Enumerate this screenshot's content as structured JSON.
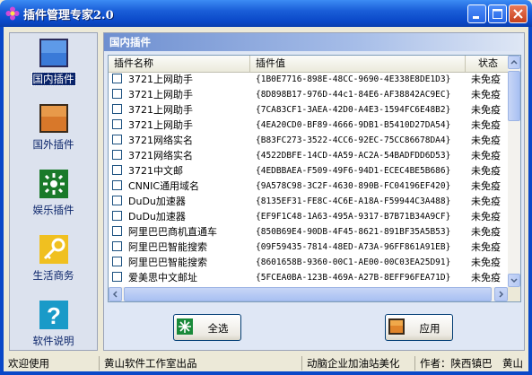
{
  "window": {
    "title": "插件管理专家2.0"
  },
  "sidebar": {
    "items": [
      {
        "label": "国内插件",
        "icon": "monitor-blue-icon",
        "active": true
      },
      {
        "label": "国外插件",
        "icon": "monitor-orange-icon",
        "active": false
      },
      {
        "label": "娱乐插件",
        "icon": "sparkle-green-icon",
        "active": false
      },
      {
        "label": "生活商务",
        "icon": "key-icon",
        "active": false
      },
      {
        "label": "软件说明",
        "icon": "help-icon",
        "active": false
      }
    ]
  },
  "panel": {
    "title": "国内插件",
    "columns": {
      "name": "插件名称",
      "value": "插件值",
      "status": "状态"
    },
    "rows": [
      {
        "name": "3721上网助手",
        "value": "{1B0E7716-898E-48CC-9690-4E338E8DE1D3}",
        "status": "未免疫"
      },
      {
        "name": "3721上网助手",
        "value": "{8D898B17-976D-44c1-84E6-AF38842AC9EC}",
        "status": "未免疫"
      },
      {
        "name": "3721上网助手",
        "value": "{7CA83CF1-3AEA-42D0-A4E3-1594FC6E48B2}",
        "status": "未免疫"
      },
      {
        "name": "3721上网助手",
        "value": "{4EA20CD0-BF89-4666-9DB1-B5410D27DA54}",
        "status": "未免疫"
      },
      {
        "name": "3721网络实名",
        "value": "{B83FC273-3522-4CC6-92EC-75CC86678DA4}",
        "status": "未免疫"
      },
      {
        "name": "3721网络实名",
        "value": "{4522DBFE-14CD-4A59-AC2A-54BADFDD6D53}",
        "status": "未免疫"
      },
      {
        "name": "3721中文邮",
        "value": "{4EDBBAEA-F509-49F6-94D1-ECEC4BE5B686}",
        "status": "未免疫"
      },
      {
        "name": "CNNIC通用域名",
        "value": "{9A578C98-3C2F-4630-890B-FC04196EF420}",
        "status": "未免疫"
      },
      {
        "name": "DuDu加速器",
        "value": "{8135EF31-FE8C-4C6E-A18A-F59944C3A488}",
        "status": "未免疫"
      },
      {
        "name": "DuDu加速器",
        "value": "{EF9F1C48-1A63-495A-9317-B7B71B34A9CF}",
        "status": "未免疫"
      },
      {
        "name": "阿里巴巴商机直通车",
        "value": "{850B69E4-90DB-4F45-8621-891BF35A5B53}",
        "status": "未免疫"
      },
      {
        "name": "阿里巴巴智能搜索",
        "value": "{09F59435-7814-48ED-A73A-96FF861A91EB}",
        "status": "未免疫"
      },
      {
        "name": "阿里巴巴智能搜索",
        "value": "{8601658B-9360-00C1-AE00-00C03EA25D91}",
        "status": "未免疫"
      },
      {
        "name": "爱美思中文邮址",
        "value": "{5FCEA0BA-123B-469A-A27B-8EFF96FEA71D}",
        "status": "未免疫"
      }
    ]
  },
  "buttons": {
    "select_all": "全选",
    "apply": "应用"
  },
  "statusbar": {
    "welcome": "欢迎使用",
    "studio": "黄山软件工作室出品",
    "beautify": "动脑企业加油站美化",
    "author": "作者：陕西镇巴　黄山"
  }
}
